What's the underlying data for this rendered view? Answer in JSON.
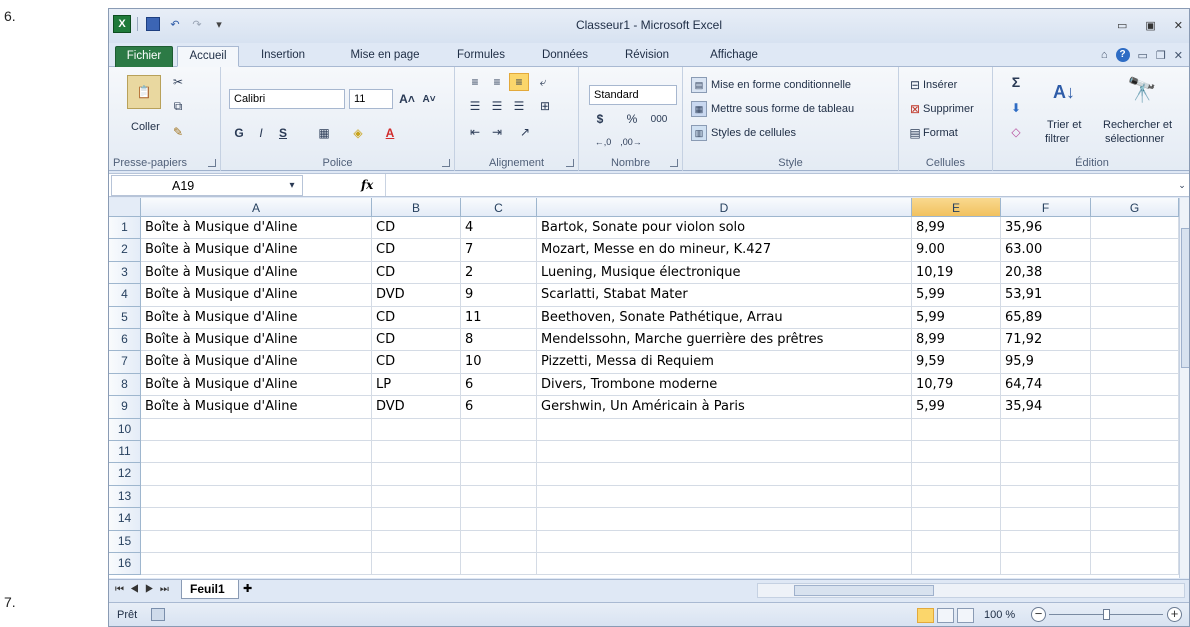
{
  "doc_numbers": {
    "before": "6.",
    "after": "7."
  },
  "window": {
    "title": "Classeur1 - Microsoft Excel"
  },
  "tabs": [
    "Fichier",
    "Accueil",
    "Insertion",
    "Mise en page",
    "Formules",
    "Données",
    "Révision",
    "Affichage"
  ],
  "ribbon": {
    "clipboard": {
      "label": "Presse-papiers",
      "paste": "Coller"
    },
    "font": {
      "label": "Police",
      "name": "Calibri",
      "size": "11",
      "bold": "G",
      "italic": "I",
      "underline": "S"
    },
    "alignment": {
      "label": "Alignement"
    },
    "number": {
      "label": "Nombre",
      "format": "Standard",
      "currency": "$",
      "percent": "%",
      "thousands": "000",
      "dec_inc": "←,0 ,00",
      "dec_dec": ",00 →,0"
    },
    "style": {
      "label": "Style",
      "cond": "Mise en forme conditionnelle",
      "table": "Mettre sous forme de tableau",
      "cell": "Styles de cellules"
    },
    "cells": {
      "label": "Cellules",
      "insert": "Insérer",
      "delete": "Supprimer",
      "format": "Format"
    },
    "edit": {
      "label": "Édition",
      "sum": "Σ",
      "sort1": "Trier et",
      "sort2": "filtrer",
      "find1": "Rechercher et",
      "find2": "sélectionner"
    }
  },
  "formula_bar": {
    "namebox": "A19",
    "fx": "fx",
    "formula": ""
  },
  "columns": [
    "A",
    "B",
    "C",
    "D",
    "E",
    "F",
    "G"
  ],
  "rows": [
    [
      "Boîte à Musique d'Aline",
      "CD",
      "4",
      "Bartok, Sonate pour violon solo",
      "8,99",
      "35,96"
    ],
    [
      "Boîte à Musique d'Aline",
      "CD",
      "7",
      "Mozart, Messe en do mineur, K.427",
      "9.00",
      "63.00"
    ],
    [
      "Boîte à Musique d'Aline",
      "CD",
      "2",
      "Luening, Musique électronique",
      "10,19",
      "20,38"
    ],
    [
      "Boîte à Musique d'Aline",
      "DVD",
      "9",
      "Scarlatti, Stabat Mater",
      "5,99",
      "53,91"
    ],
    [
      "Boîte à Musique d'Aline",
      "CD",
      "11",
      "Beethoven, Sonate Pathétique, Arrau",
      "5,99",
      "65,89"
    ],
    [
      "Boîte à Musique d'Aline",
      "CD",
      "8",
      "Mendelssohn, Marche guerrière des prêtres",
      "8,99",
      "71,92"
    ],
    [
      "Boîte à Musique d'Aline",
      "CD",
      "10",
      "Pizzetti, Messa di Requiem",
      "9,59",
      "95,9"
    ],
    [
      "Boîte à Musique d'Aline",
      "LP",
      "6",
      "Divers, Trombone moderne",
      "10,79",
      "64,74"
    ],
    [
      "Boîte à Musique d'Aline",
      "DVD",
      "6",
      "Gershwin, Un Américain à Paris",
      "5,99",
      "35,94"
    ]
  ],
  "row_numbers": [
    "1",
    "2",
    "3",
    "4",
    "5",
    "6",
    "7",
    "8",
    "9",
    "10",
    "11",
    "12",
    "13",
    "14",
    "15",
    "16"
  ],
  "sheet_tab": "Feuil1",
  "status": {
    "ready": "Prêt",
    "zoom": "100 %"
  }
}
